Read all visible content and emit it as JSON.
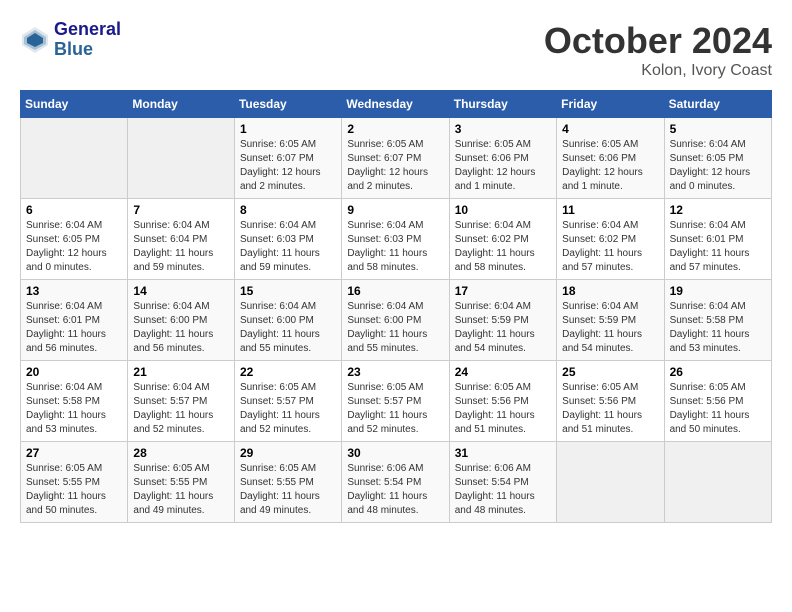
{
  "header": {
    "logo_line1": "General",
    "logo_line2": "Blue",
    "month": "October 2024",
    "location": "Kolon, Ivory Coast"
  },
  "weekdays": [
    "Sunday",
    "Monday",
    "Tuesday",
    "Wednesday",
    "Thursday",
    "Friday",
    "Saturday"
  ],
  "weeks": [
    [
      {
        "day": "",
        "info": ""
      },
      {
        "day": "",
        "info": ""
      },
      {
        "day": "1",
        "info": "Sunrise: 6:05 AM\nSunset: 6:07 PM\nDaylight: 12 hours\nand 2 minutes."
      },
      {
        "day": "2",
        "info": "Sunrise: 6:05 AM\nSunset: 6:07 PM\nDaylight: 12 hours\nand 2 minutes."
      },
      {
        "day": "3",
        "info": "Sunrise: 6:05 AM\nSunset: 6:06 PM\nDaylight: 12 hours\nand 1 minute."
      },
      {
        "day": "4",
        "info": "Sunrise: 6:05 AM\nSunset: 6:06 PM\nDaylight: 12 hours\nand 1 minute."
      },
      {
        "day": "5",
        "info": "Sunrise: 6:04 AM\nSunset: 6:05 PM\nDaylight: 12 hours\nand 0 minutes."
      }
    ],
    [
      {
        "day": "6",
        "info": "Sunrise: 6:04 AM\nSunset: 6:05 PM\nDaylight: 12 hours\nand 0 minutes."
      },
      {
        "day": "7",
        "info": "Sunrise: 6:04 AM\nSunset: 6:04 PM\nDaylight: 11 hours\nand 59 minutes."
      },
      {
        "day": "8",
        "info": "Sunrise: 6:04 AM\nSunset: 6:03 PM\nDaylight: 11 hours\nand 59 minutes."
      },
      {
        "day": "9",
        "info": "Sunrise: 6:04 AM\nSunset: 6:03 PM\nDaylight: 11 hours\nand 58 minutes."
      },
      {
        "day": "10",
        "info": "Sunrise: 6:04 AM\nSunset: 6:02 PM\nDaylight: 11 hours\nand 58 minutes."
      },
      {
        "day": "11",
        "info": "Sunrise: 6:04 AM\nSunset: 6:02 PM\nDaylight: 11 hours\nand 57 minutes."
      },
      {
        "day": "12",
        "info": "Sunrise: 6:04 AM\nSunset: 6:01 PM\nDaylight: 11 hours\nand 57 minutes."
      }
    ],
    [
      {
        "day": "13",
        "info": "Sunrise: 6:04 AM\nSunset: 6:01 PM\nDaylight: 11 hours\nand 56 minutes."
      },
      {
        "day": "14",
        "info": "Sunrise: 6:04 AM\nSunset: 6:00 PM\nDaylight: 11 hours\nand 56 minutes."
      },
      {
        "day": "15",
        "info": "Sunrise: 6:04 AM\nSunset: 6:00 PM\nDaylight: 11 hours\nand 55 minutes."
      },
      {
        "day": "16",
        "info": "Sunrise: 6:04 AM\nSunset: 6:00 PM\nDaylight: 11 hours\nand 55 minutes."
      },
      {
        "day": "17",
        "info": "Sunrise: 6:04 AM\nSunset: 5:59 PM\nDaylight: 11 hours\nand 54 minutes."
      },
      {
        "day": "18",
        "info": "Sunrise: 6:04 AM\nSunset: 5:59 PM\nDaylight: 11 hours\nand 54 minutes."
      },
      {
        "day": "19",
        "info": "Sunrise: 6:04 AM\nSunset: 5:58 PM\nDaylight: 11 hours\nand 53 minutes."
      }
    ],
    [
      {
        "day": "20",
        "info": "Sunrise: 6:04 AM\nSunset: 5:58 PM\nDaylight: 11 hours\nand 53 minutes."
      },
      {
        "day": "21",
        "info": "Sunrise: 6:04 AM\nSunset: 5:57 PM\nDaylight: 11 hours\nand 52 minutes."
      },
      {
        "day": "22",
        "info": "Sunrise: 6:05 AM\nSunset: 5:57 PM\nDaylight: 11 hours\nand 52 minutes."
      },
      {
        "day": "23",
        "info": "Sunrise: 6:05 AM\nSunset: 5:57 PM\nDaylight: 11 hours\nand 52 minutes."
      },
      {
        "day": "24",
        "info": "Sunrise: 6:05 AM\nSunset: 5:56 PM\nDaylight: 11 hours\nand 51 minutes."
      },
      {
        "day": "25",
        "info": "Sunrise: 6:05 AM\nSunset: 5:56 PM\nDaylight: 11 hours\nand 51 minutes."
      },
      {
        "day": "26",
        "info": "Sunrise: 6:05 AM\nSunset: 5:56 PM\nDaylight: 11 hours\nand 50 minutes."
      }
    ],
    [
      {
        "day": "27",
        "info": "Sunrise: 6:05 AM\nSunset: 5:55 PM\nDaylight: 11 hours\nand 50 minutes."
      },
      {
        "day": "28",
        "info": "Sunrise: 6:05 AM\nSunset: 5:55 PM\nDaylight: 11 hours\nand 49 minutes."
      },
      {
        "day": "29",
        "info": "Sunrise: 6:05 AM\nSunset: 5:55 PM\nDaylight: 11 hours\nand 49 minutes."
      },
      {
        "day": "30",
        "info": "Sunrise: 6:06 AM\nSunset: 5:54 PM\nDaylight: 11 hours\nand 48 minutes."
      },
      {
        "day": "31",
        "info": "Sunrise: 6:06 AM\nSunset: 5:54 PM\nDaylight: 11 hours\nand 48 minutes."
      },
      {
        "day": "",
        "info": ""
      },
      {
        "day": "",
        "info": ""
      }
    ]
  ]
}
